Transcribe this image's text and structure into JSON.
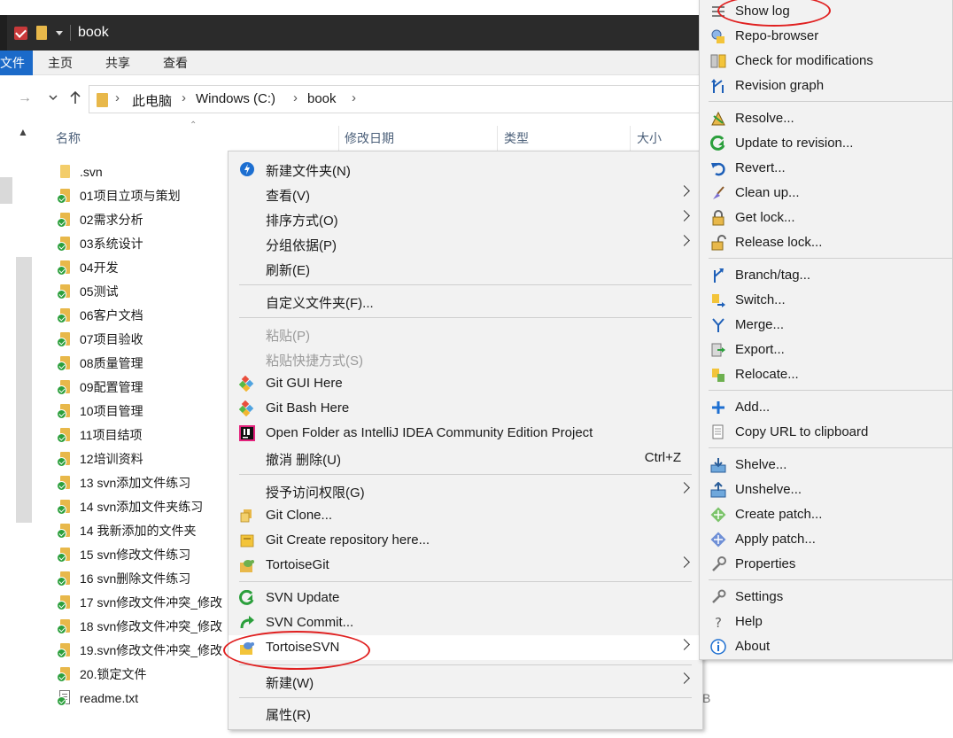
{
  "window": {
    "title": "book"
  },
  "ribbon": {
    "file": "文件",
    "tabs": [
      "主页",
      "共享",
      "查看"
    ]
  },
  "address": {
    "path": [
      "此电脑",
      "Windows (C:)",
      "book"
    ]
  },
  "columns": [
    "名称",
    "修改日期",
    "类型",
    "大小"
  ],
  "files": [
    {
      "name": ".svn",
      "kind": "plain"
    },
    {
      "name": "01项目立项与策划",
      "kind": "svn"
    },
    {
      "name": "02需求分析",
      "kind": "svn"
    },
    {
      "name": "03系统设计",
      "kind": "svn"
    },
    {
      "name": "04开发",
      "kind": "svn"
    },
    {
      "name": "05测试",
      "kind": "svn"
    },
    {
      "name": "06客户文档",
      "kind": "svn"
    },
    {
      "name": "07项目验收",
      "kind": "svn"
    },
    {
      "name": "08质量管理",
      "kind": "svn"
    },
    {
      "name": "09配置管理",
      "kind": "svn"
    },
    {
      "name": "10项目管理",
      "kind": "svn"
    },
    {
      "name": "11项目结项",
      "kind": "svn"
    },
    {
      "name": "12培训资料",
      "kind": "svn"
    },
    {
      "name": "13 svn添加文件练习",
      "kind": "svn"
    },
    {
      "name": "14 svn添加文件夹练习",
      "kind": "svn"
    },
    {
      "name": "14 我新添加的文件夹",
      "kind": "svn"
    },
    {
      "name": "15 svn修改文件练习",
      "kind": "svn"
    },
    {
      "name": "16 svn删除文件练习",
      "kind": "svn"
    },
    {
      "name": "17 svn修改文件冲突_修改",
      "kind": "svn"
    },
    {
      "name": "18 svn修改文件冲突_修改",
      "kind": "svn"
    },
    {
      "name": "19.svn修改文件冲突_修改",
      "kind": "svn"
    },
    {
      "name": "20.锁定文件",
      "kind": "svn"
    },
    {
      "name": "readme.txt",
      "kind": "doc"
    }
  ],
  "stray_text": "B",
  "context_menu": {
    "new_folder": "新建文件夹(N)",
    "view": "查看(V)",
    "sort": "排序方式(O)",
    "group": "分组依据(P)",
    "refresh": "刷新(E)",
    "customize": "自定义文件夹(F)...",
    "paste": "粘贴(P)",
    "paste_shortcut": "粘贴快捷方式(S)",
    "git_gui": "Git GUI Here",
    "git_bash": "Git Bash Here",
    "intellij": "Open Folder as IntelliJ IDEA Community Edition Project",
    "undo": "撤消 删除(U)",
    "undo_shortcut": "Ctrl+Z",
    "grant_access": "授予访问权限(G)",
    "git_clone": "Git Clone...",
    "git_create": "Git Create repository here...",
    "tortoisegit": "TortoiseGit",
    "svn_update": "SVN Update",
    "svn_commit": "SVN Commit...",
    "tortoisesvn": "TortoiseSVN",
    "new": "新建(W)",
    "properties": "属性(R)"
  },
  "svn_menu": {
    "show_log": "Show log",
    "repo_browser": "Repo-browser",
    "check_mods": "Check for modifications",
    "revision_graph": "Revision graph",
    "resolve": "Resolve...",
    "update_to_rev": "Update to revision...",
    "revert": "Revert...",
    "clean_up": "Clean up...",
    "get_lock": "Get lock...",
    "release_lock": "Release lock...",
    "branch_tag": "Branch/tag...",
    "switch": "Switch...",
    "merge": "Merge...",
    "export": "Export...",
    "relocate": "Relocate...",
    "add": "Add...",
    "copy_url": "Copy URL to clipboard",
    "shelve": "Shelve...",
    "unshelve": "Unshelve...",
    "create_patch": "Create patch...",
    "apply_patch": "Apply patch...",
    "properties": "Properties",
    "settings": "Settings",
    "help": "Help",
    "about": "About"
  },
  "colors": {
    "accent": "#1b6ac9",
    "annotation": "#e02020",
    "svn_ok": "#2b9f3c",
    "folder": "#e8b84a"
  }
}
